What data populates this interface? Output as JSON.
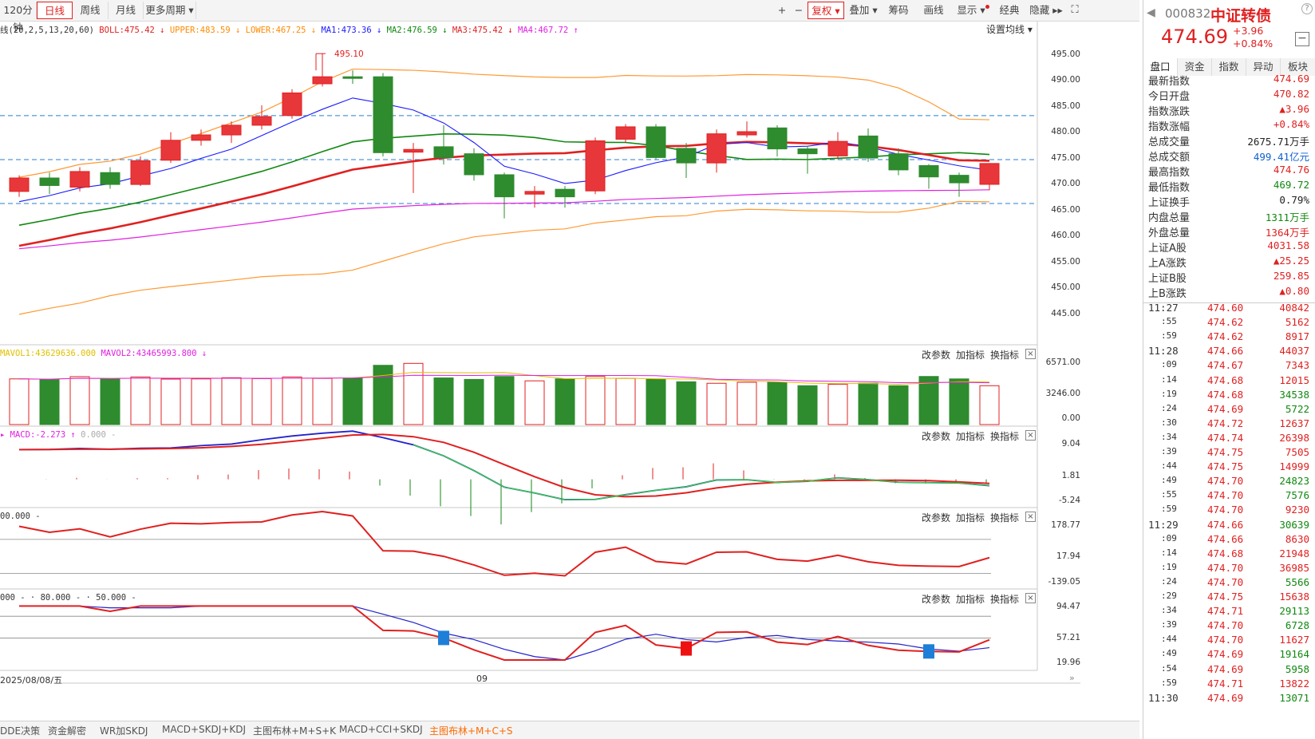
{
  "toolbar": {
    "period_tabs": [
      "120分钟",
      "日线",
      "周线",
      "月线",
      "更多周期 ▾"
    ],
    "active_period": "日线",
    "right_buttons": [
      "+",
      "−",
      "复权 ▾",
      "叠加 ▾",
      "筹码",
      "画线",
      "显示 ▾",
      "经典",
      "隐藏 ▸▸"
    ]
  },
  "main_legend": {
    "boll": "BOLL:475.42",
    "upper": "UPPER:483.59",
    "lower": "LOWER:467.25",
    "ma1": "MA1:473.36",
    "ma2": "MA2:476.59",
    "ma3": "MA3:475.42",
    "ma4": "MA4:467.72",
    "prefix": "线(20,2,5,13,20,60)",
    "settings": "设置均线 ▾",
    "high_marker": "495.10"
  },
  "panel_buttons": {
    "edit": "改参数",
    "add": "加指标",
    "swap": "换指标",
    "close": "×"
  },
  "vol_legend": {
    "mavol1": "MAVOL1:43629636.000",
    "mavol2": "MAVOL2:43465993.800"
  },
  "macd_legend": {
    "macd": "MACD:-2.273",
    "dif": "0.000 -"
  },
  "cci_legend": {
    "label": "00.000 -"
  },
  "kdj_legend": {
    "a": "000 -",
    "b": "80.000 -",
    "c": "50.000 -"
  },
  "price_axis": [
    "495.00",
    "490.00",
    "485.00",
    "480.00",
    "475.00",
    "470.00",
    "465.00",
    "460.00",
    "455.00",
    "450.00",
    "445.00"
  ],
  "vol_axis": [
    "6571.00",
    "3246.00",
    "0.00"
  ],
  "macd_axis": [
    "9.04",
    "1.81",
    "-5.24"
  ],
  "cci_axis": [
    "178.77",
    "17.94",
    "-139.05"
  ],
  "kdj_axis": [
    "94.47",
    "57.21",
    "19.96"
  ],
  "date_label": "2025/08/08/五",
  "month_label": "09",
  "bottom_tabs": [
    "DDE决策",
    "资金解密",
    "WR加SKDJ",
    "MACD+SKDJ+KDJ",
    "主图布林+M+S+K",
    "MACD+CCI+SKDJ",
    "主图布林+M+C+S"
  ],
  "active_bottom_tab": "主图布林+M+C+S",
  "quote": {
    "code": "000832",
    "name": "中证转债",
    "price": "474.69",
    "change": "+3.96",
    "change_pct": "+0.84%",
    "tabs": [
      "盘口",
      "资金",
      "指数",
      "异动",
      "板块"
    ],
    "rows": [
      {
        "k": "最新指数",
        "v": "474.69",
        "c": "red"
      },
      {
        "k": "今日开盘",
        "v": "470.82",
        "c": "red"
      },
      {
        "k": "指数涨跌",
        "v": "▲3.96",
        "c": "red"
      },
      {
        "k": "指数涨幅",
        "v": "+0.84%",
        "c": "red"
      },
      {
        "k": "总成交量",
        "v": "2675.71万手",
        "c": "black"
      },
      {
        "k": "总成交额",
        "v": "499.41亿元",
        "c": "blue"
      },
      {
        "k": "最高指数",
        "v": "474.76",
        "c": "red"
      },
      {
        "k": "最低指数",
        "v": "469.72",
        "c": "green"
      },
      {
        "k": "上证换手",
        "v": "0.79%",
        "c": "black"
      },
      {
        "k": "内盘总量",
        "v": "1311万手",
        "c": "green"
      },
      {
        "k": "外盘总量",
        "v": "1364万手",
        "c": "red"
      },
      {
        "k": "上证A股",
        "v": "4031.58",
        "c": "red"
      },
      {
        "k": "上A涨跌",
        "v": "▲25.25",
        "c": "red"
      },
      {
        "k": "上证B股",
        "v": "259.85",
        "c": "red"
      },
      {
        "k": "上B涨跌",
        "v": "▲0.80",
        "c": "red"
      }
    ],
    "ticks": [
      {
        "t": "11:27",
        "p": "474.60",
        "q": "40842",
        "c": "red",
        "big": true
      },
      {
        "t": ":55",
        "p": "474.62",
        "q": "5162",
        "c": "red"
      },
      {
        "t": ":59",
        "p": "474.62",
        "q": "8917",
        "c": "red"
      },
      {
        "t": "11:28",
        "p": "474.66",
        "q": "44037",
        "c": "red",
        "big": true
      },
      {
        "t": ":09",
        "p": "474.67",
        "q": "7343",
        "c": "red"
      },
      {
        "t": ":14",
        "p": "474.68",
        "q": "12015",
        "c": "red"
      },
      {
        "t": ":19",
        "p": "474.68",
        "q": "34538",
        "c": "green"
      },
      {
        "t": ":24",
        "p": "474.69",
        "q": "5722",
        "c": "green"
      },
      {
        "t": ":30",
        "p": "474.72",
        "q": "12637",
        "c": "red"
      },
      {
        "t": ":34",
        "p": "474.74",
        "q": "26398",
        "c": "red"
      },
      {
        "t": ":39",
        "p": "474.75",
        "q": "7505",
        "c": "red"
      },
      {
        "t": ":44",
        "p": "474.75",
        "q": "14999",
        "c": "red"
      },
      {
        "t": ":49",
        "p": "474.70",
        "q": "24823",
        "c": "green"
      },
      {
        "t": ":55",
        "p": "474.70",
        "q": "7576",
        "c": "green"
      },
      {
        "t": ":59",
        "p": "474.70",
        "q": "9230",
        "c": "red"
      },
      {
        "t": "11:29",
        "p": "474.66",
        "q": "30639",
        "c": "green",
        "big": true
      },
      {
        "t": ":09",
        "p": "474.66",
        "q": "8630",
        "c": "red"
      },
      {
        "t": ":14",
        "p": "474.68",
        "q": "21948",
        "c": "red"
      },
      {
        "t": ":19",
        "p": "474.70",
        "q": "36985",
        "c": "red"
      },
      {
        "t": ":24",
        "p": "474.70",
        "q": "5566",
        "c": "green"
      },
      {
        "t": ":29",
        "p": "474.75",
        "q": "15638",
        "c": "red"
      },
      {
        "t": ":34",
        "p": "474.71",
        "q": "29113",
        "c": "green"
      },
      {
        "t": ":39",
        "p": "474.70",
        "q": "6728",
        "c": "green"
      },
      {
        "t": ":44",
        "p": "474.70",
        "q": "11627",
        "c": "red"
      },
      {
        "t": ":49",
        "p": "474.69",
        "q": "19164",
        "c": "green"
      },
      {
        "t": ":54",
        "p": "474.69",
        "q": "5958",
        "c": "green"
      },
      {
        "t": ":59",
        "p": "474.71",
        "q": "13822",
        "c": "red"
      },
      {
        "t": "11:30",
        "p": "474.69",
        "q": "13071",
        "c": "green",
        "big": true
      }
    ]
  },
  "chart_data": {
    "type": "candlestick",
    "candles": [
      {
        "o": 469.5,
        "c": 472.0,
        "h": 472.5,
        "l": 468.5
      },
      {
        "o": 472.0,
        "c": 470.6,
        "h": 473.0,
        "l": 469.0
      },
      {
        "o": 470.3,
        "c": 473.2,
        "h": 474.0,
        "l": 469.5
      },
      {
        "o": 473.0,
        "c": 470.8,
        "h": 474.0,
        "l": 470.0
      },
      {
        "o": 470.8,
        "c": 475.2,
        "h": 476.0,
        "l": 470.5
      },
      {
        "o": 475.3,
        "c": 479.0,
        "h": 480.5,
        "l": 474.8
      },
      {
        "o": 479.0,
        "c": 480.0,
        "h": 481.0,
        "l": 478.0
      },
      {
        "o": 480.0,
        "c": 481.8,
        "h": 482.5,
        "l": 478.5
      },
      {
        "o": 481.8,
        "c": 483.4,
        "h": 485.5,
        "l": 481.0
      },
      {
        "o": 483.6,
        "c": 487.8,
        "h": 488.5,
        "l": 483.0
      },
      {
        "o": 489.5,
        "c": 490.8,
        "h": 495.1,
        "l": 489.0
      },
      {
        "o": 490.8,
        "c": 490.5,
        "h": 492.0,
        "l": 489.5
      },
      {
        "o": 490.8,
        "c": 476.7,
        "h": 491.5,
        "l": 476.0
      },
      {
        "o": 476.8,
        "c": 477.3,
        "h": 478.5,
        "l": 469.2
      },
      {
        "o": 477.8,
        "c": 475.8,
        "h": 481.8,
        "l": 474.5
      },
      {
        "o": 476.5,
        "c": 472.6,
        "h": 477.5,
        "l": 471.5
      },
      {
        "o": 472.6,
        "c": 468.5,
        "h": 473.0,
        "l": 464.5
      },
      {
        "o": 469.0,
        "c": 469.5,
        "h": 470.5,
        "l": 466.5
      },
      {
        "o": 469.9,
        "c": 468.5,
        "h": 470.5,
        "l": 466.5
      },
      {
        "o": 469.6,
        "c": 478.9,
        "h": 479.5,
        "l": 469.0
      },
      {
        "o": 479.2,
        "c": 481.5,
        "h": 482.0,
        "l": 478.5
      },
      {
        "o": 481.5,
        "c": 475.8,
        "h": 482.0,
        "l": 475.5
      },
      {
        "o": 477.5,
        "c": 474.8,
        "h": 478.5,
        "l": 472.0
      },
      {
        "o": 474.8,
        "c": 480.2,
        "h": 481.0,
        "l": 473.0
      },
      {
        "o": 480.0,
        "c": 480.6,
        "h": 482.5,
        "l": 479.5
      },
      {
        "o": 481.3,
        "c": 477.4,
        "h": 481.8,
        "l": 476.0
      },
      {
        "o": 477.4,
        "c": 476.5,
        "h": 478.0,
        "l": 472.8
      },
      {
        "o": 476.1,
        "c": 478.8,
        "h": 480.5,
        "l": 475.5
      },
      {
        "o": 479.8,
        "c": 475.7,
        "h": 481.2,
        "l": 475.0
      },
      {
        "o": 476.5,
        "c": 473.5,
        "h": 477.5,
        "l": 472.5
      },
      {
        "o": 474.3,
        "c": 472.2,
        "h": 474.6,
        "l": 470.0
      },
      {
        "o": 472.5,
        "c": 471.1,
        "h": 473.0,
        "l": 468.5
      },
      {
        "o": 470.82,
        "c": 474.69,
        "h": 474.76,
        "l": 469.72
      }
    ],
    "volumes": [
      4700,
      4650,
      4930,
      4700,
      4900,
      4680,
      4700,
      4820,
      4730,
      4900,
      4750,
      4800,
      6100,
      6300,
      4800,
      4650,
      4950,
      4500,
      4700,
      4950,
      4750,
      4650,
      4400,
      4250,
      4350,
      4350,
      4000,
      4150,
      4250,
      4000,
      4950,
      4700,
      4000,
      4850,
      3160
    ],
    "y_range": [
      442.5,
      497.5
    ]
  }
}
